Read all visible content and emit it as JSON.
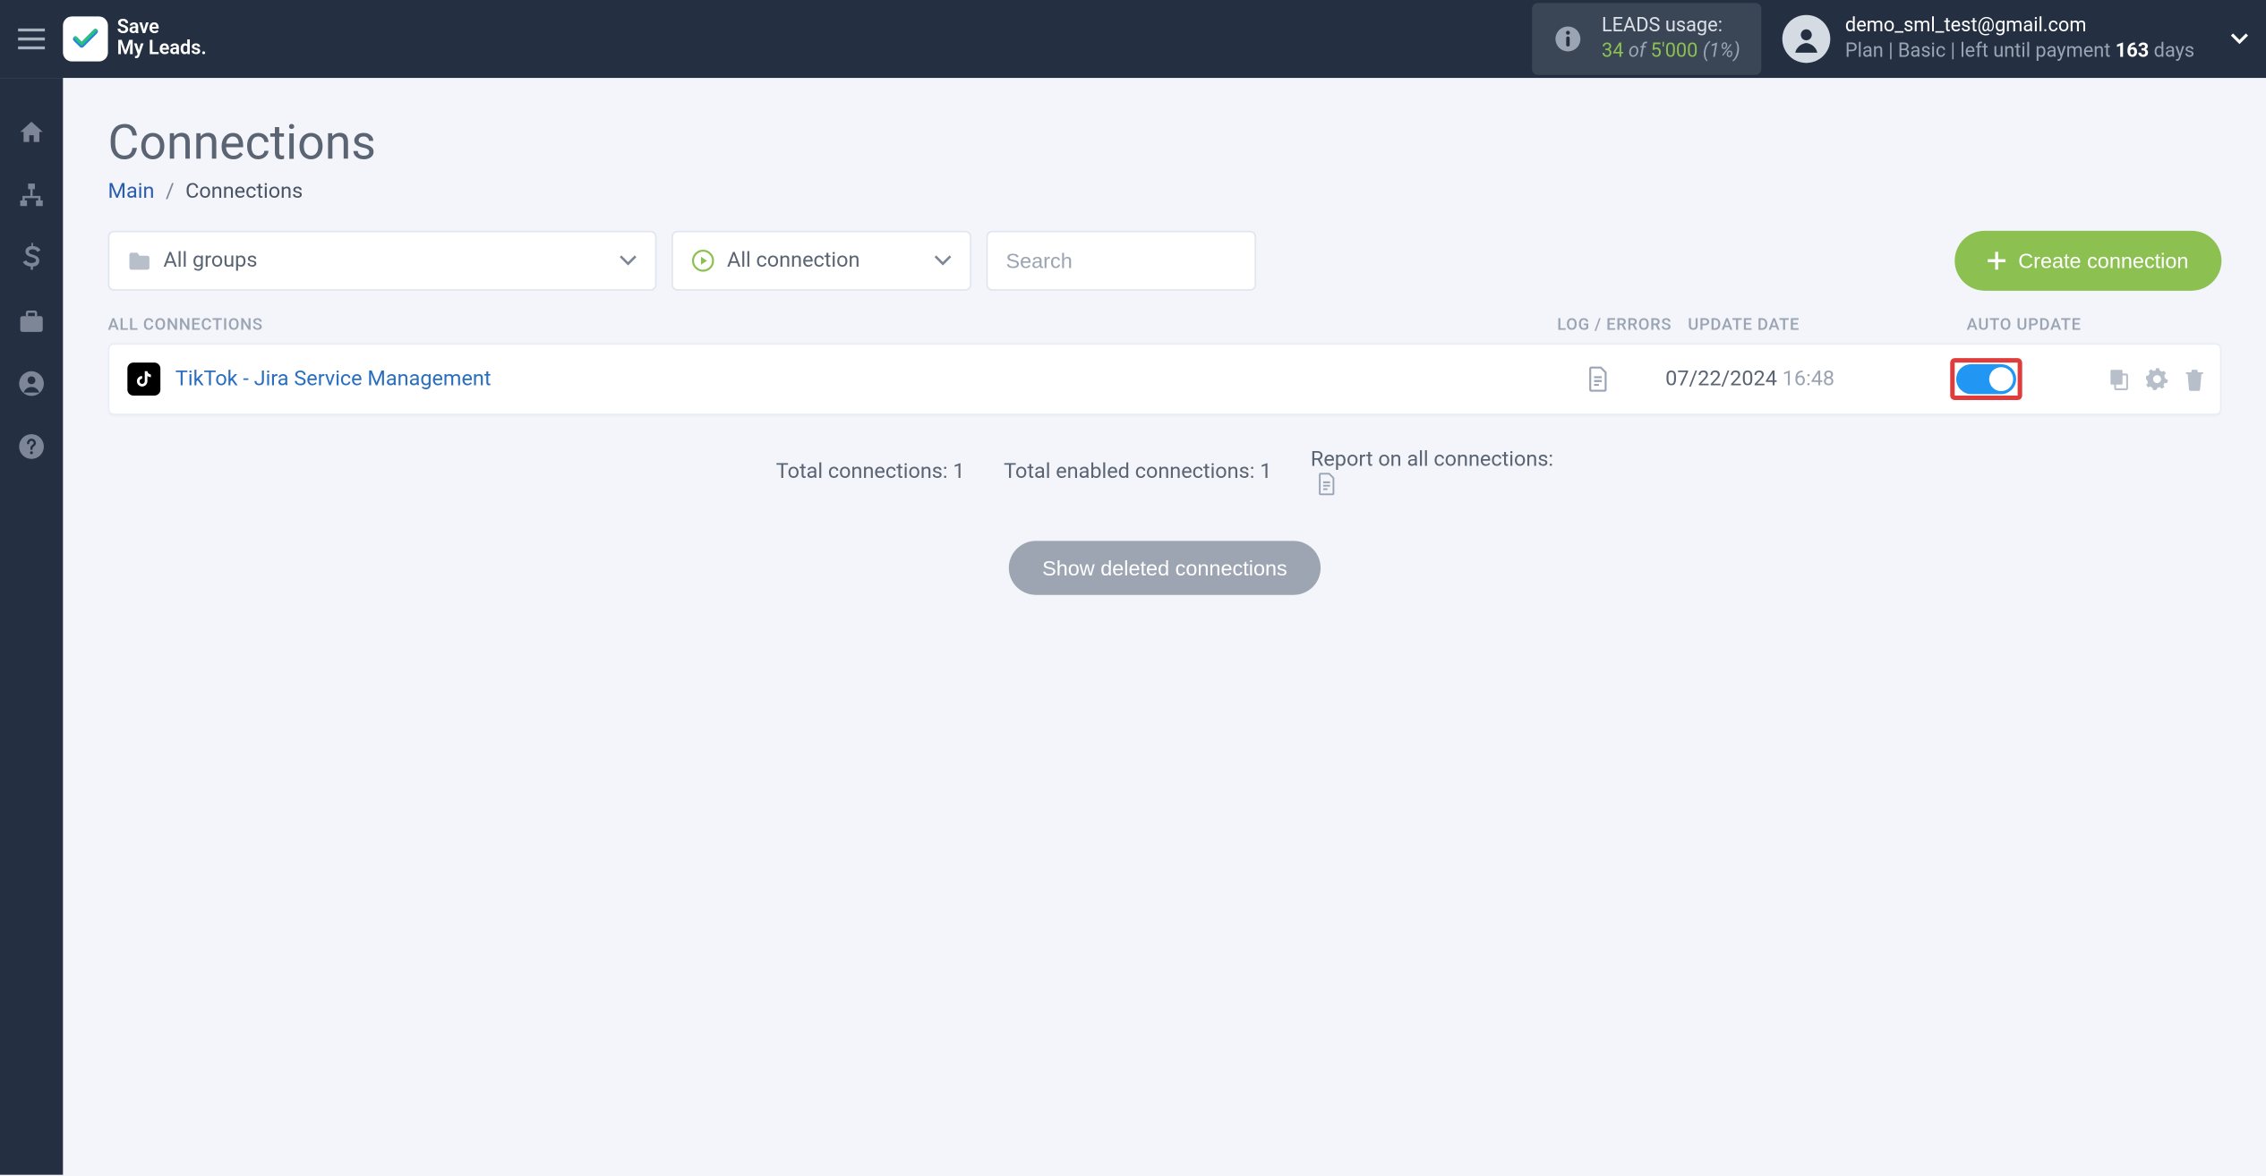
{
  "brand": {
    "line1": "Save",
    "line2": "My Leads."
  },
  "header": {
    "leads": {
      "label": "LEADS usage:",
      "used": "34",
      "of": "of",
      "total": "5'000",
      "pct": "(1%)"
    },
    "user": {
      "email": "demo_sml_test@gmail.com",
      "plan_prefix": "Plan | Basic |  left until payment ",
      "days": "163",
      "days_suffix": " days"
    }
  },
  "page": {
    "title": "Connections",
    "breadcrumb": {
      "main": "Main",
      "sep": "/",
      "current": "Connections"
    }
  },
  "filters": {
    "groups": "All groups",
    "status": "All connection",
    "search_placeholder": "Search",
    "create_label": "Create connection"
  },
  "columns": {
    "all": "ALL CONNECTIONS",
    "log": "LOG / ERRORS",
    "date": "UPDATE DATE",
    "auto": "AUTO UPDATE"
  },
  "rows": [
    {
      "name": "TikTok - Jira Service Management",
      "date": "07/22/2024",
      "time": "16:48",
      "auto_on": true
    }
  ],
  "stats": {
    "total": "Total connections: 1",
    "enabled": "Total enabled connections: 1",
    "report": "Report on all connections:"
  },
  "buttons": {
    "show_deleted": "Show deleted connections"
  }
}
